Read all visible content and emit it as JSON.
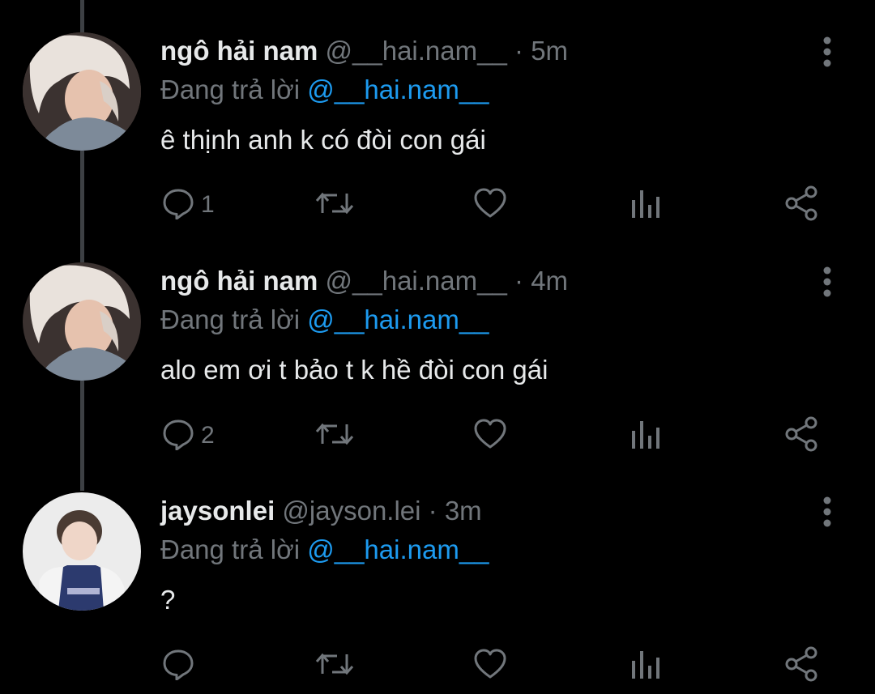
{
  "colors": {
    "background": "#000000",
    "primary_text": "#e7e9ea",
    "secondary_text": "#71767b",
    "link": "#1d9bf0",
    "thread_line": "#3d4044"
  },
  "tweets": [
    {
      "name": "ngô hải nam",
      "handle": "@__hai.nam__",
      "separator": "·",
      "time": "5m",
      "reply_prefix": "Đang trả lời",
      "reply_to": "@__hai.nam__",
      "text": "ê thịnh anh k có đòi con gái",
      "reply_count": "1",
      "avatar_icon": "avatar-blond-man"
    },
    {
      "name": "ngô hải nam",
      "handle": "@__hai.nam__",
      "separator": "·",
      "time": "4m",
      "reply_prefix": "Đang trả lời",
      "reply_to": "@__hai.nam__",
      "text": "alo em ơi t bảo t k hề đòi con gái",
      "reply_count": "2",
      "avatar_icon": "avatar-blond-man"
    },
    {
      "name": "jaysonlei",
      "handle": "@jayson.lei",
      "separator": "·",
      "time": "3m",
      "reply_prefix": "Đang trả lời",
      "reply_to": "@__hai.nam__",
      "text": "?",
      "reply_count": "",
      "avatar_icon": "avatar-jersey-person"
    }
  ],
  "icons": {
    "reply": "reply-icon",
    "retweet": "retweet-icon",
    "like": "heart-icon",
    "views": "views-icon",
    "share": "share-icon",
    "more": "more-vertical-icon"
  }
}
